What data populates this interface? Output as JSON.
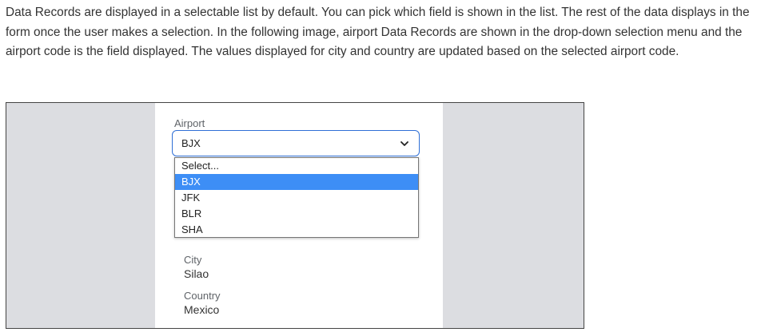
{
  "paragraph": "Data Records are displayed in a selectable list by default. You can pick which field is shown in the list. The rest of the data displays in the form once the user makes a selection. In the following image, airport Data Records are shown in the drop-down selection menu and the airport code is the field displayed. The values displayed for city and country are updated based on the selected airport code.",
  "form": {
    "airport_label": "Airport",
    "selected_value": "BJX",
    "options": [
      "Select...",
      "BJX",
      "JFK",
      "BLR",
      "SHA"
    ],
    "highlighted_index": 1,
    "city_label": "City",
    "city_value": "Silao",
    "country_label": "Country",
    "country_value": "Mexico"
  },
  "colors": {
    "accent": "#2f6fd6",
    "highlight": "#3d8ef6",
    "backdrop": "#dcdde1"
  },
  "icons": {
    "dropdown": "chevron-down-icon"
  }
}
